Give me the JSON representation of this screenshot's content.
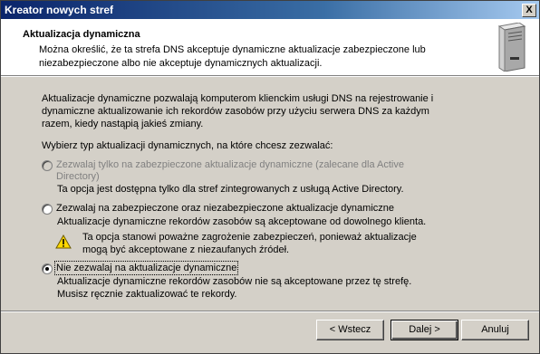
{
  "window": {
    "title": "Kreator nowych stref",
    "close_label": "X"
  },
  "header": {
    "title": "Aktualizacja dynamiczna",
    "subtitle": "Można określić, że ta strefa DNS akceptuje dynamiczne aktualizacje zabezpieczone lub niezabezpieczone albo nie akceptuje dynamicznych aktualizacji.",
    "icon": "server-icon"
  },
  "content": {
    "intro": "Aktualizacje dynamiczne pozwalają komputerom klienckim usługi DNS na rejestrowanie i dynamiczne aktualizowanie ich rekordów zasobów przy użyciu serwera DNS za każdym razem, kiedy nastąpią jakieś zmiany.",
    "prompt": "Wybierz typ aktualizacji dynamicznych, na które chcesz zezwalać:",
    "options": [
      {
        "label": "Zezwalaj tylko na zabezpieczone aktualizacje dynamiczne (zalecane dla Active Directory)",
        "description": "Ta opcja jest dostępna tylko dla stref zintegrowanych z usługą Active Directory.",
        "enabled": false,
        "selected": false
      },
      {
        "label": "Zezwalaj na zabezpieczone oraz niezabezpieczone aktualizacje dynamiczne",
        "description": "Aktualizacje dynamiczne rekordów zasobów są akceptowane od dowolnego klienta.",
        "warning": "Ta opcja stanowi poważne zagrożenie zabezpieczeń, ponieważ aktualizacje mogą być akceptowane z niezaufanych źródeł.",
        "enabled": true,
        "selected": false
      },
      {
        "label": "Nie zezwalaj na aktualizacje dynamiczne",
        "description": "Aktualizacje dynamiczne rekordów zasobów nie są akceptowane przez tę strefę. Musisz ręcznie zaktualizować te rekordy.",
        "enabled": true,
        "selected": true
      }
    ]
  },
  "buttons": {
    "back": "< Wstecz",
    "next": "Dalej >",
    "cancel": "Anuluj"
  }
}
